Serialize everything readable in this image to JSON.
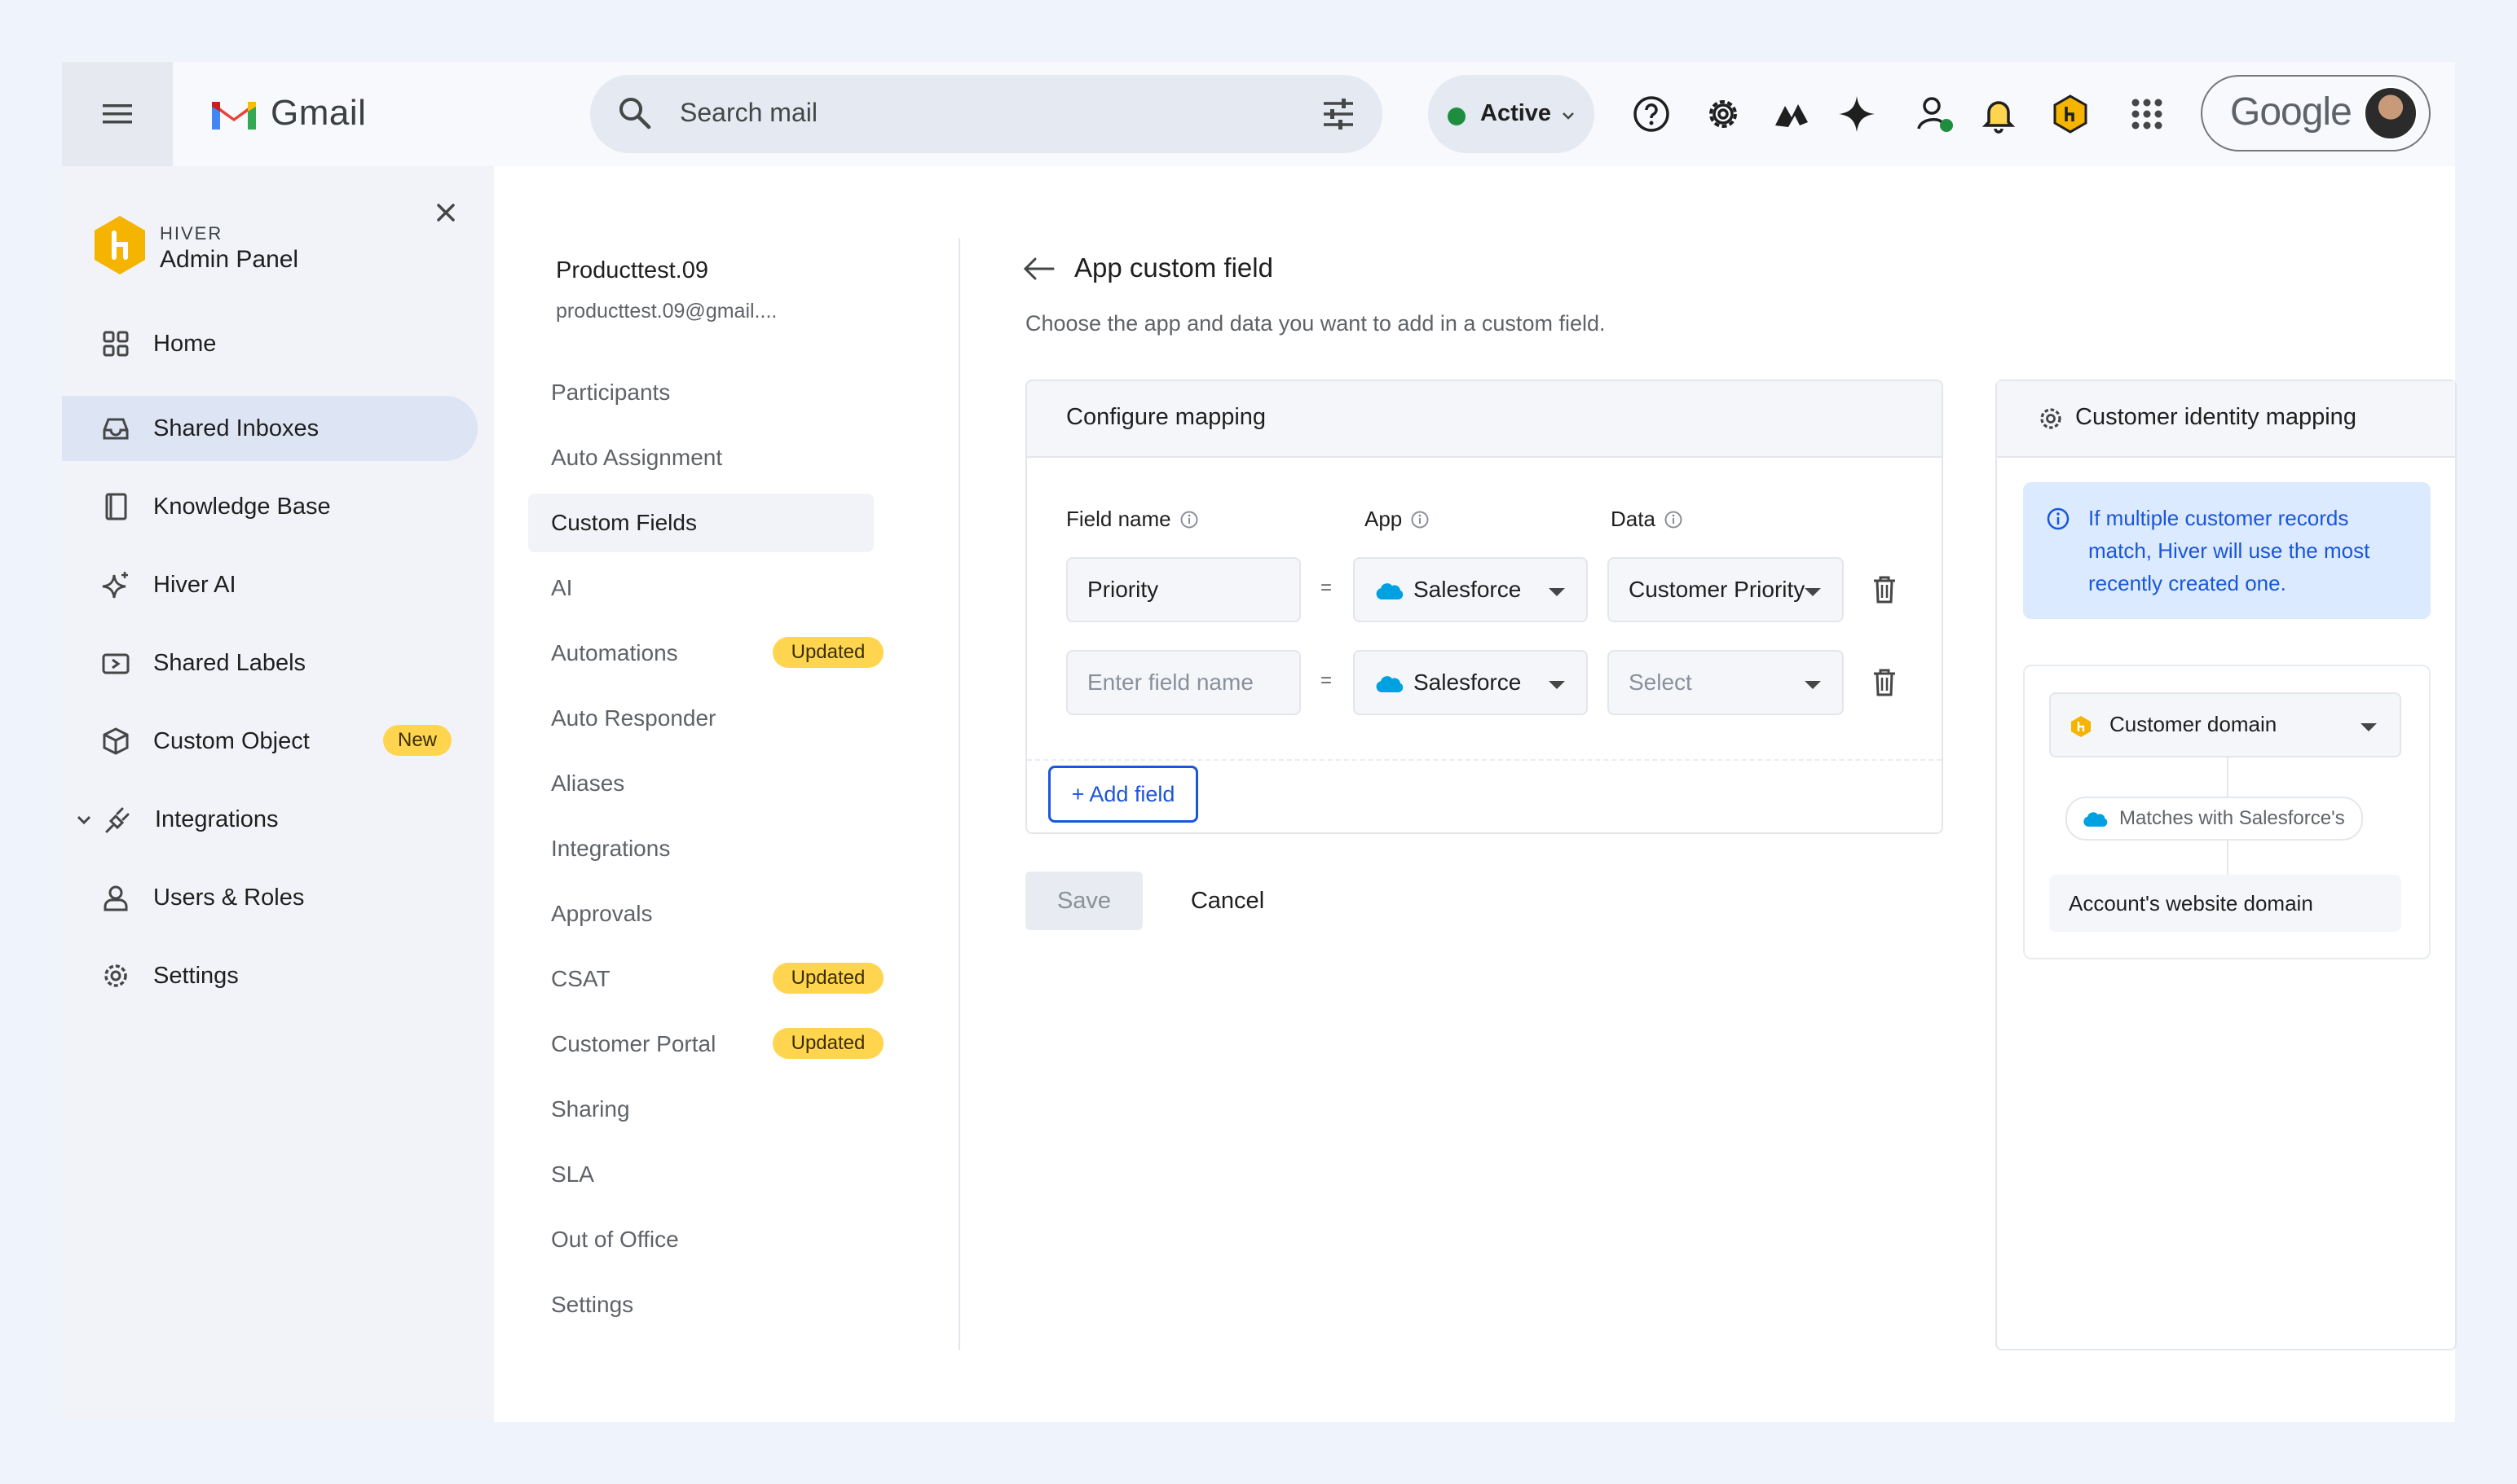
{
  "gmail": {
    "app_name": "Gmail",
    "search_placeholder": "Search mail",
    "status_label": "Active",
    "google_label": "Google",
    "colors": {
      "status_green": "#1e8e3e",
      "active_nav_bg": "#dde4f4"
    },
    "top_icons": [
      "help-icon",
      "settings-gear-icon",
      "hiver-app-icon",
      "gemini-sparkle-icon",
      "contacts-status-icon",
      "notification-bell-icon",
      "hiver-hex-icon",
      "apps-grid-icon"
    ]
  },
  "hiver_panel": {
    "brand_small": "HIVER",
    "brand_title": "Admin Panel",
    "nav": [
      {
        "label": "Home",
        "icon": "home-grid-icon"
      },
      {
        "label": "Shared Inboxes",
        "icon": "inbox-tray-icon",
        "active": true
      },
      {
        "label": "Knowledge Base",
        "icon": "book-icon"
      },
      {
        "label": "Hiver AI",
        "icon": "sparkle-icon"
      },
      {
        "label": "Shared Labels",
        "icon": "label-tag-icon"
      },
      {
        "label": "Custom Object",
        "icon": "cube-icon",
        "badge": "New"
      },
      {
        "label": "Integrations",
        "icon": "plug-icon",
        "expandable": true
      },
      {
        "label": "Users & Roles",
        "icon": "user-icon"
      },
      {
        "label": "Settings",
        "icon": "gear-icon"
      }
    ]
  },
  "inbox": {
    "name": "Producttest.09",
    "email": "producttest.09@gmail....",
    "settings_menu": [
      {
        "label": "Participants"
      },
      {
        "label": "Auto Assignment"
      },
      {
        "label": "Custom Fields",
        "active": true
      },
      {
        "label": "AI"
      },
      {
        "label": "Automations",
        "badge": "Updated"
      },
      {
        "label": "Auto Responder"
      },
      {
        "label": "Aliases"
      },
      {
        "label": "Integrations"
      },
      {
        "label": "Approvals"
      },
      {
        "label": "CSAT",
        "badge": "Updated"
      },
      {
        "label": "Customer Portal",
        "badge": "Updated"
      },
      {
        "label": "Sharing"
      },
      {
        "label": "SLA"
      },
      {
        "label": "Out of Office"
      },
      {
        "label": "Settings"
      }
    ]
  },
  "form": {
    "title": "App custom field",
    "subtitle": "Choose the app and data you want to add in a custom field.",
    "card_title": "Configure mapping",
    "columns": {
      "field_name": "Field name",
      "app": "App",
      "data": "Data"
    },
    "equals": "=",
    "rows": [
      {
        "field_value": "Priority",
        "field_placeholder": "Enter field name",
        "app": "Salesforce",
        "data": "Customer Priority",
        "data_placeholder": "Select"
      },
      {
        "field_value": "",
        "field_placeholder": "Enter field name",
        "app": "Salesforce",
        "data": "",
        "data_placeholder": "Select"
      }
    ],
    "add_field": "+ Add field",
    "save": "Save",
    "cancel": "Cancel"
  },
  "identity": {
    "title": "Customer identity mapping",
    "info": "If multiple customer records match, Hiver will use the most recently created one.",
    "domain_select": "Customer domain",
    "matches": "Matches with Salesforce's",
    "target": "Account's website domain"
  }
}
